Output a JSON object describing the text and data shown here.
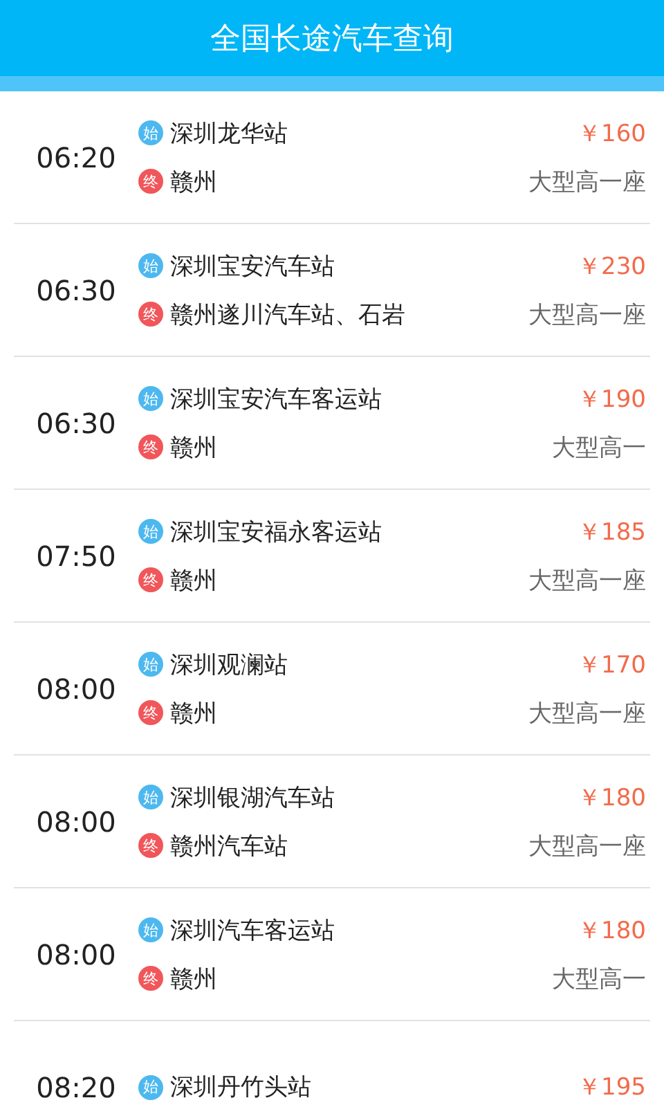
{
  "header": {
    "title": "全国长途汽车查询"
  },
  "trips": [
    {
      "time": "06:20",
      "origin_badge": "始",
      "origin": "深圳龙华站",
      "destination_badge": "终",
      "destination": "赣州",
      "price": "￥160",
      "seat_type": "大型高一座"
    },
    {
      "time": "06:30",
      "origin_badge": "始",
      "origin": "深圳宝安汽车站",
      "destination_badge": "终",
      "destination": "赣州遂川汽车站、石岩",
      "price": "￥230",
      "seat_type": "大型高一座"
    },
    {
      "time": "06:30",
      "origin_badge": "始",
      "origin": "深圳宝安汽车客运站",
      "destination_badge": "终",
      "destination": "赣州",
      "price": "￥190",
      "seat_type": "大型高一"
    },
    {
      "time": "07:50",
      "origin_badge": "始",
      "origin": "深圳宝安福永客运站",
      "destination_badge": "终",
      "destination": "赣州",
      "price": "￥185",
      "seat_type": "大型高一座"
    },
    {
      "time": "08:00",
      "origin_badge": "始",
      "origin": "深圳观澜站",
      "destination_badge": "终",
      "destination": "赣州",
      "price": "￥170",
      "seat_type": "大型高一座"
    },
    {
      "time": "08:00",
      "origin_badge": "始",
      "origin": "深圳银湖汽车站",
      "destination_badge": "终",
      "destination": "赣州汽车站",
      "price": "￥180",
      "seat_type": "大型高一座"
    },
    {
      "time": "08:00",
      "origin_badge": "始",
      "origin": "深圳汽车客运站",
      "destination_badge": "终",
      "destination": "赣州",
      "price": "￥180",
      "seat_type": "大型高一"
    },
    {
      "time": "08:20",
      "origin_badge": "始",
      "origin": "深圳丹竹头站",
      "price": "￥195"
    }
  ]
}
